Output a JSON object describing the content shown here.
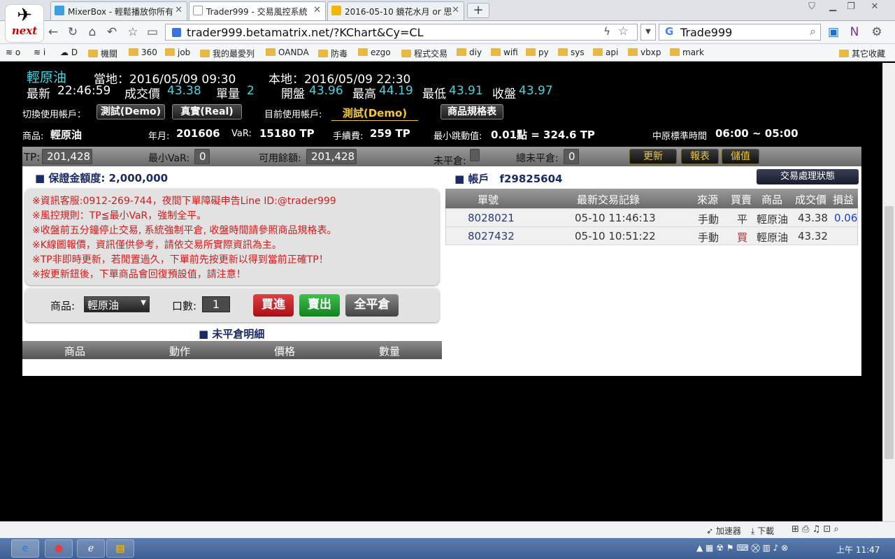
{
  "browser": {
    "tabs": [
      {
        "title": "MixerBox - 輕鬆播放你所有",
        "active": false
      },
      {
        "title": "Trader999 - 交易風控系統",
        "active": true
      },
      {
        "title": "2016-05-10 鏡花水月 or 思",
        "active": false
      }
    ],
    "newtab_label": "+",
    "logo_text": "next",
    "url": "trader999.betamatrix.net/?KChart&Cy=CL",
    "search": "Trade999",
    "bookmarks": [
      "o",
      "i",
      "D",
      "機關",
      "360",
      "job",
      "我的最愛列",
      "OANDA",
      "防毒",
      "ezgo",
      "程式交易",
      "diy",
      "wifi",
      "py",
      "sys",
      "api",
      "vbxp",
      "mark",
      "其它收藏"
    ]
  },
  "quote": {
    "symbol": "輕原油",
    "local_label": "當地：",
    "local_time": "2016/05/09  09:30",
    "here_label": "本地：",
    "here_time": "2016/05/09  22:30",
    "latest_label": "最新",
    "latest_time": "22:46:59",
    "price_label": "成交價",
    "price": "43.38",
    "qty_label": "單量",
    "qty": "2",
    "open_label": "開盤",
    "open": "43.96",
    "high_label": "最高",
    "high": "44.19",
    "low_label": "最低",
    "low": "43.91",
    "close_label": "收盤",
    "close": "43.97"
  },
  "account_switch": {
    "label": "切換使用帳戶：",
    "demo_btn": "測試(Demo)",
    "real_btn": "真實(Real)",
    "current_label": "目前使用帳戶:",
    "current": "測試(Demo)",
    "spec_btn": "商品規格表"
  },
  "product_info": {
    "product_label": "商品:",
    "product": "輕原油",
    "month_label": "年月:",
    "month": "201606",
    "var_label": "VaR:",
    "var": "15180 TP",
    "fee_label": "手續費:",
    "fee": "259 TP",
    "tick_label": "最小跳動值:",
    "tick": "0.01點 = 324.6 TP",
    "hours_label": "中原標準時間",
    "hours": "06:00 ~ 05:00"
  },
  "infobar": {
    "tp_label": "TP:",
    "tp": "201,428",
    "minvar_label": "最小VaR:",
    "minvar": "0",
    "avail_label": "可用餘額:",
    "avail": "201,428",
    "open_pos_label": "未平倉:",
    "total_open_label": "總未平倉:",
    "total_open": "0",
    "refresh_btn": "更新",
    "report_btn": "報表",
    "deposit_btn": "儲值"
  },
  "margin": {
    "label": "保證金額度:",
    "value": "2,000,000"
  },
  "notices": [
    "※資訊客服:0912-269-744，夜間下單障礙申告Line ID:@trader999",
    "※風控規則：TP≦最小VaR，強制全平。",
    "※收盤前五分鐘停止交易, 系統強制平倉, 收盤時間請參照商品規格表。",
    "※K線圖報價，資訊僅供參考，請依交易所實際資訊為主。",
    "※TP非即時更新，若閒置過久，下單前先按更新以得到當前正確TP！",
    "※按更新鈕後，下單商品會回復預設值，請注意！"
  ],
  "order": {
    "product_label": "商品:",
    "product": "輕原油",
    "lots_label": "口數:",
    "lots": "1",
    "buy_btn": "買進",
    "sell_btn": "賣出",
    "closeall_btn": "全平倉"
  },
  "positions": {
    "title": "未平倉明細",
    "headers": [
      "商品",
      "動作",
      "價格",
      "數量"
    ]
  },
  "account": {
    "label": "帳戶",
    "id": "f29825604",
    "status_btn": "交易處理狀態"
  },
  "history": {
    "headers": [
      "單號",
      "最新交易記錄",
      "來源",
      "買賣",
      "商品",
      "成交價",
      "損益"
    ],
    "rows": [
      [
        "8028021",
        "05-10 11:46:13",
        "手動",
        "平",
        "輕原油",
        "43.38",
        "0.06"
      ],
      [
        "8027432",
        "05-10 10:51:22",
        "手動",
        "買",
        "輕原油",
        "43.32",
        ""
      ]
    ]
  },
  "statusbar": {
    "accel": "加速器",
    "download": "下載"
  },
  "clock": "上午 11:47",
  "colors": {
    "cyan": "#3fd8e4",
    "red": "#d41b1b",
    "gold": "#f3c735",
    "buy": "#c9202a",
    "sell": "#23a035"
  }
}
